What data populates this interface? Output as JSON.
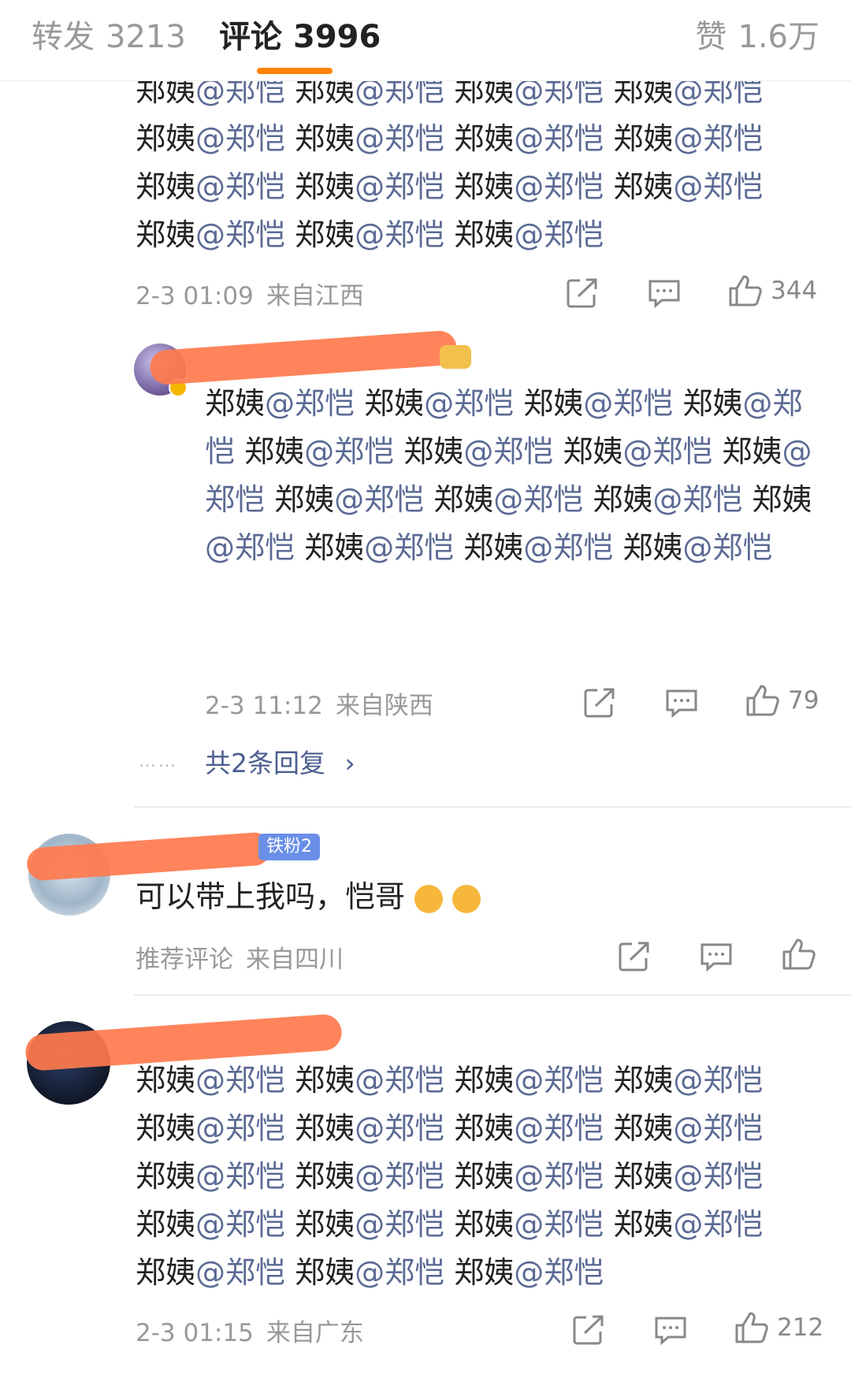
{
  "tabs": {
    "repost_label": "转发",
    "repost_count": "3213",
    "comment_label": "评论",
    "comment_count": "3996",
    "like_label": "赞",
    "like_count": "1.6万",
    "accent": "#ff8200"
  },
  "comments": [
    {
      "segments": [
        "郑姨",
        "@郑恺"
      ],
      "lines_top_clipped": 1,
      "full_lines": 3,
      "line_pairs": [
        4,
        4,
        4,
        3
      ],
      "time": "2-3 01:09",
      "location": "来自江西",
      "likes": "344"
    },
    {
      "reply": true,
      "text": "郑姨@郑恺 郑姨@郑恺 郑姨@郑恺 郑姨@郑恺 郑姨@郑恺 郑姨@郑恺 郑姨@郑恺 郑姨@郑恺 郑姨@郑恺 郑姨@郑恺 郑姨@郑恺 郑姨@郑恺 郑姨@郑恺 郑姨@郑恺 郑姨@郑恺",
      "time": "2-3 11:12",
      "location": "来自陕西",
      "likes": "79",
      "more_replies": "共2条回复",
      "more_dots": "……"
    },
    {
      "badge": "铁粉2",
      "text": "可以带上我吗，恺哥",
      "time": "推荐评论",
      "location": "来自四川"
    },
    {
      "line_pairs": [
        4,
        4,
        4,
        4,
        3
      ],
      "time": "2-3 01:15",
      "location": "来自广东",
      "likes": "212"
    }
  ],
  "icons": [
    "share-icon",
    "comment-icon",
    "thumbs-up-icon",
    "cry-emoji-icon",
    "chevron-right-icon",
    "verified-icon",
    "crown-icon"
  ],
  "colors": {
    "mention": "#5b6a94",
    "meta": "#999999",
    "badge": "#6a8fe8",
    "redaction": "#ff7a4d"
  }
}
